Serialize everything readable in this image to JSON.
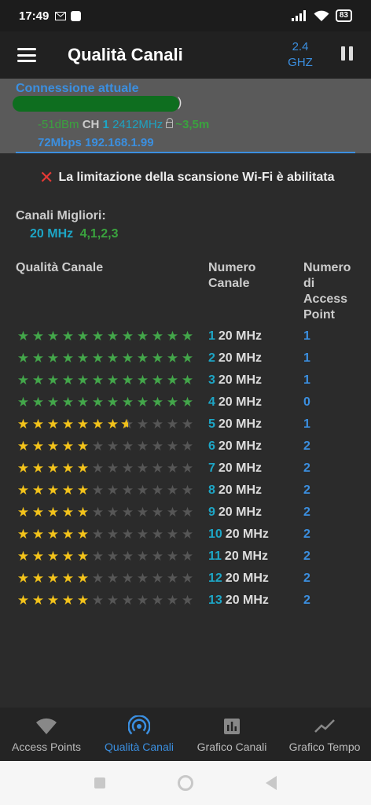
{
  "status_bar": {
    "time": "17:49",
    "battery": "83"
  },
  "app_bar": {
    "title": "Qualità Canali",
    "band_line1": "2.4",
    "band_line2": "GHZ"
  },
  "connection": {
    "title": "Connessione attuale",
    "ssid_bracket": ")",
    "signal": "-51dBm",
    "ch_label": "CH",
    "channel": "1",
    "frequency": "2412MHz",
    "distance": "~3,5m",
    "speed": "72Mbps",
    "ip": "192.168.1.99"
  },
  "warning": {
    "text": "La limitazione della scansione Wi-Fi è abilitata"
  },
  "best_channels": {
    "label": "Canali Migliori:",
    "width": "20 MHz",
    "list": "4,1,2,3"
  },
  "table": {
    "header_quality": "Qualità Canale",
    "header_channel_l1": "Numero",
    "header_channel_l2": "Canale",
    "header_ap_l1": "Numero",
    "header_ap_l2": "di",
    "header_ap_l3": "Access",
    "header_ap_l4": "Point",
    "max_stars": 12,
    "rows": [
      {
        "channel": "1",
        "width": "20 MHz",
        "ap": "1",
        "rating": 12,
        "color": "green"
      },
      {
        "channel": "2",
        "width": "20 MHz",
        "ap": "1",
        "rating": 12,
        "color": "green"
      },
      {
        "channel": "3",
        "width": "20 MHz",
        "ap": "1",
        "rating": 12,
        "color": "green"
      },
      {
        "channel": "4",
        "width": "20 MHz",
        "ap": "0",
        "rating": 12,
        "color": "green"
      },
      {
        "channel": "5",
        "width": "20 MHz",
        "ap": "1",
        "rating": 7.5,
        "color": "yellow"
      },
      {
        "channel": "6",
        "width": "20 MHz",
        "ap": "2",
        "rating": 5,
        "color": "yellow"
      },
      {
        "channel": "7",
        "width": "20 MHz",
        "ap": "2",
        "rating": 5,
        "color": "yellow"
      },
      {
        "channel": "8",
        "width": "20 MHz",
        "ap": "2",
        "rating": 5,
        "color": "yellow"
      },
      {
        "channel": "9",
        "width": "20 MHz",
        "ap": "2",
        "rating": 5,
        "color": "yellow"
      },
      {
        "channel": "10",
        "width": "20 MHz",
        "ap": "2",
        "rating": 5,
        "color": "yellow"
      },
      {
        "channel": "11",
        "width": "20 MHz",
        "ap": "2",
        "rating": 5,
        "color": "yellow"
      },
      {
        "channel": "12",
        "width": "20 MHz",
        "ap": "2",
        "rating": 5,
        "color": "yellow"
      },
      {
        "channel": "13",
        "width": "20 MHz",
        "ap": "2",
        "rating": 5,
        "color": "yellow"
      }
    ]
  },
  "bottom_nav": [
    {
      "label": "Access Points",
      "icon": "wifi-icon",
      "active": false
    },
    {
      "label": "Qualità Canali",
      "icon": "signal-quality-icon",
      "active": true
    },
    {
      "label": "Grafico Canali",
      "icon": "bar-chart-icon",
      "active": false
    },
    {
      "label": "Grafico Tempo",
      "icon": "line-chart-icon",
      "active": false
    }
  ],
  "colors": {
    "accent": "#3b8fe0",
    "green": "#43a64a",
    "yellow": "#f2c21b",
    "teal": "#1da6c6"
  }
}
